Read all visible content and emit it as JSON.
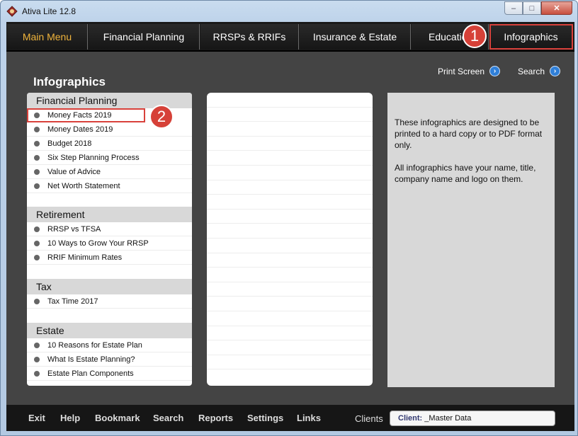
{
  "window": {
    "title": "Ativa Lite 12.8",
    "controls": {
      "min": "–",
      "max": "□",
      "close": "✕"
    }
  },
  "tabs": [
    {
      "label": "Main Menu"
    },
    {
      "label": "Financial Planning"
    },
    {
      "label": "RRSPs & RRIFs"
    },
    {
      "label": "Insurance & Estate"
    },
    {
      "label": "Educatio"
    },
    {
      "label": "Infographics"
    }
  ],
  "annotations": {
    "one": "1",
    "two": "2"
  },
  "page": {
    "title": "Infographics",
    "print_screen": "Print Screen",
    "search": "Search"
  },
  "sections": [
    {
      "title": "Financial Planning",
      "items": [
        "Money Facts 2019",
        "Money Dates 2019",
        "Budget 2018",
        "Six Step Planning Process",
        "Value of Advice",
        "Net Worth Statement"
      ]
    },
    {
      "title": "Retirement",
      "items": [
        "RRSP vs TFSA",
        "10 Ways to Grow Your RRSP",
        "RRIF Minimum Rates"
      ]
    },
    {
      "title": "Tax",
      "items": [
        "Tax Time 2017"
      ]
    },
    {
      "title": "Estate",
      "items": [
        "10 Reasons for Estate Plan",
        "What Is Estate Planning?",
        "Estate Plan Components"
      ]
    }
  ],
  "info": {
    "p1": "These infographics are designed to be printed to a hard copy or to PDF format only.",
    "p2": "All infographics have your name, title, company name and logo on them."
  },
  "bottom": {
    "nav": [
      "Exit",
      "Help",
      "Bookmark",
      "Search",
      "Reports",
      "Settings",
      "Links"
    ],
    "clients_label": "Clients",
    "client_prefix": "Client:",
    "client_value": "_Master Data"
  }
}
